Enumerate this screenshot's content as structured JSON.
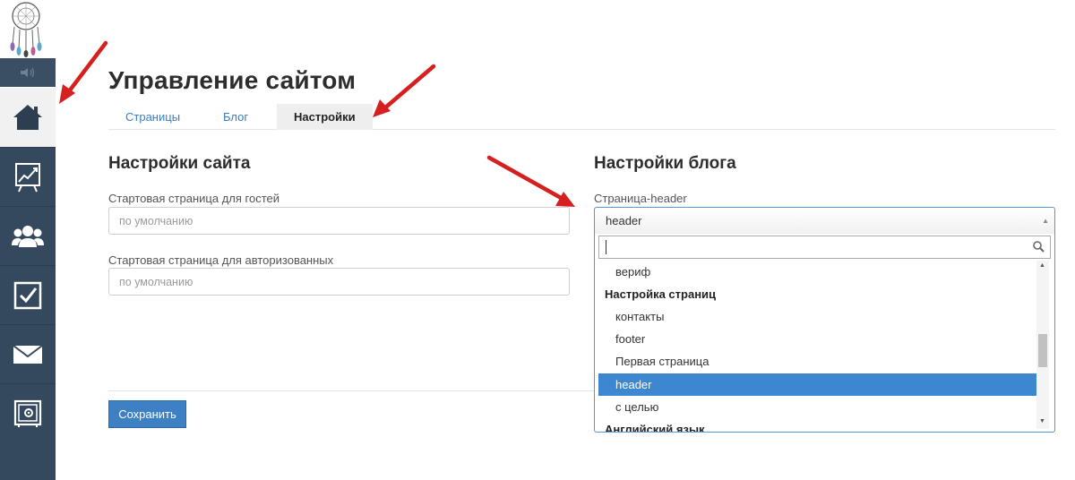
{
  "page": {
    "title": "Управление сайтом",
    "tabs": [
      {
        "label": "Страницы"
      },
      {
        "label": "Блог"
      },
      {
        "label": "Настройки"
      }
    ]
  },
  "site_settings": {
    "title": "Настройки сайта",
    "guest_start": {
      "label": "Стартовая страница для гостей",
      "placeholder": "по умолчанию",
      "value": ""
    },
    "auth_start": {
      "label": "Стартовая страница для авторизованных",
      "placeholder": "по умолчанию",
      "value": ""
    },
    "save_label": "Сохранить"
  },
  "blog_settings": {
    "title": "Настройки блога",
    "header_page": {
      "label": "Страница-header",
      "selected": "header",
      "search_value": "",
      "options": [
        {
          "label": "вериф",
          "type": "option"
        },
        {
          "label": "Настройка страниц",
          "type": "group"
        },
        {
          "label": "контакты",
          "type": "option"
        },
        {
          "label": "footer",
          "type": "option"
        },
        {
          "label": "Первая страница",
          "type": "option"
        },
        {
          "label": "header",
          "type": "option",
          "selected": true
        },
        {
          "label": "с целью",
          "type": "option"
        },
        {
          "label": "Английский язык",
          "type": "group"
        }
      ]
    }
  },
  "sidebar": {
    "items": [
      {
        "icon": "home-icon",
        "active": true
      },
      {
        "icon": "chart-icon",
        "active": false
      },
      {
        "icon": "users-icon",
        "active": false
      },
      {
        "icon": "checkbox-icon",
        "active": false
      },
      {
        "icon": "mail-icon",
        "active": false
      },
      {
        "icon": "safe-icon",
        "active": false
      }
    ],
    "volume_icon": "volume-icon"
  },
  "colors": {
    "sidebar_bg": "#34495e",
    "accent": "#3c87cf",
    "link": "#3b7dc4",
    "arrow": "#d61f1f"
  }
}
